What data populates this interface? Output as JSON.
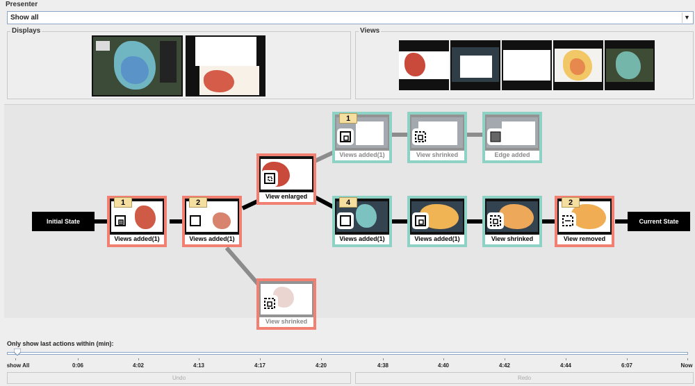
{
  "presenter": {
    "title": "Presenter",
    "selected": "Show all"
  },
  "displays": {
    "title": "Displays"
  },
  "views": {
    "title": "Views"
  },
  "graph": {
    "initial_label": "Initial State",
    "current_label": "Current State",
    "nodes": [
      {
        "id": "n1",
        "caption": "Views added(1)",
        "badge": "1",
        "icon": "views-added-icon"
      },
      {
        "id": "n2",
        "caption": "Views added(1)",
        "badge": "2",
        "icon": "views-added-icon"
      },
      {
        "id": "n3",
        "caption": "View enlarged",
        "badge": "",
        "icon": "view-enlarged-icon"
      },
      {
        "id": "n4",
        "caption": "View shrinked",
        "badge": "",
        "icon": "view-shrinked-icon"
      },
      {
        "id": "n5",
        "caption": "Views added(1)",
        "badge": "1",
        "icon": "views-added-icon"
      },
      {
        "id": "n6",
        "caption": "View shrinked",
        "badge": "",
        "icon": "view-shrinked-icon"
      },
      {
        "id": "n7",
        "caption": "Edge added",
        "badge": "",
        "icon": "edge-added-icon"
      },
      {
        "id": "n8",
        "caption": "Views added(1)",
        "badge": "4",
        "icon": "views-added-icon"
      },
      {
        "id": "n9",
        "caption": "Views added(1)",
        "badge": "",
        "icon": "views-added-icon"
      },
      {
        "id": "n10",
        "caption": "View shrinked",
        "badge": "",
        "icon": "view-shrinked-icon"
      },
      {
        "id": "n11",
        "caption": "View removed",
        "badge": "2",
        "icon": "view-removed-icon"
      }
    ]
  },
  "filter": {
    "label": "Only show last actions within (min):",
    "ticks": [
      "show All",
      "0:06",
      "4:02",
      "4:13",
      "4:17",
      "4:20",
      "4:38",
      "4:40",
      "4:42",
      "4:44",
      "6:07",
      "Now"
    ]
  },
  "buttons": {
    "undo": "Undo",
    "redo": "Redo"
  },
  "colors": {
    "red_node": "#f28072",
    "teal_node": "#8ed2c6",
    "badge": "#f5dfa0",
    "edge_strong": "#000000",
    "edge_weak": "#8c8c8c"
  }
}
